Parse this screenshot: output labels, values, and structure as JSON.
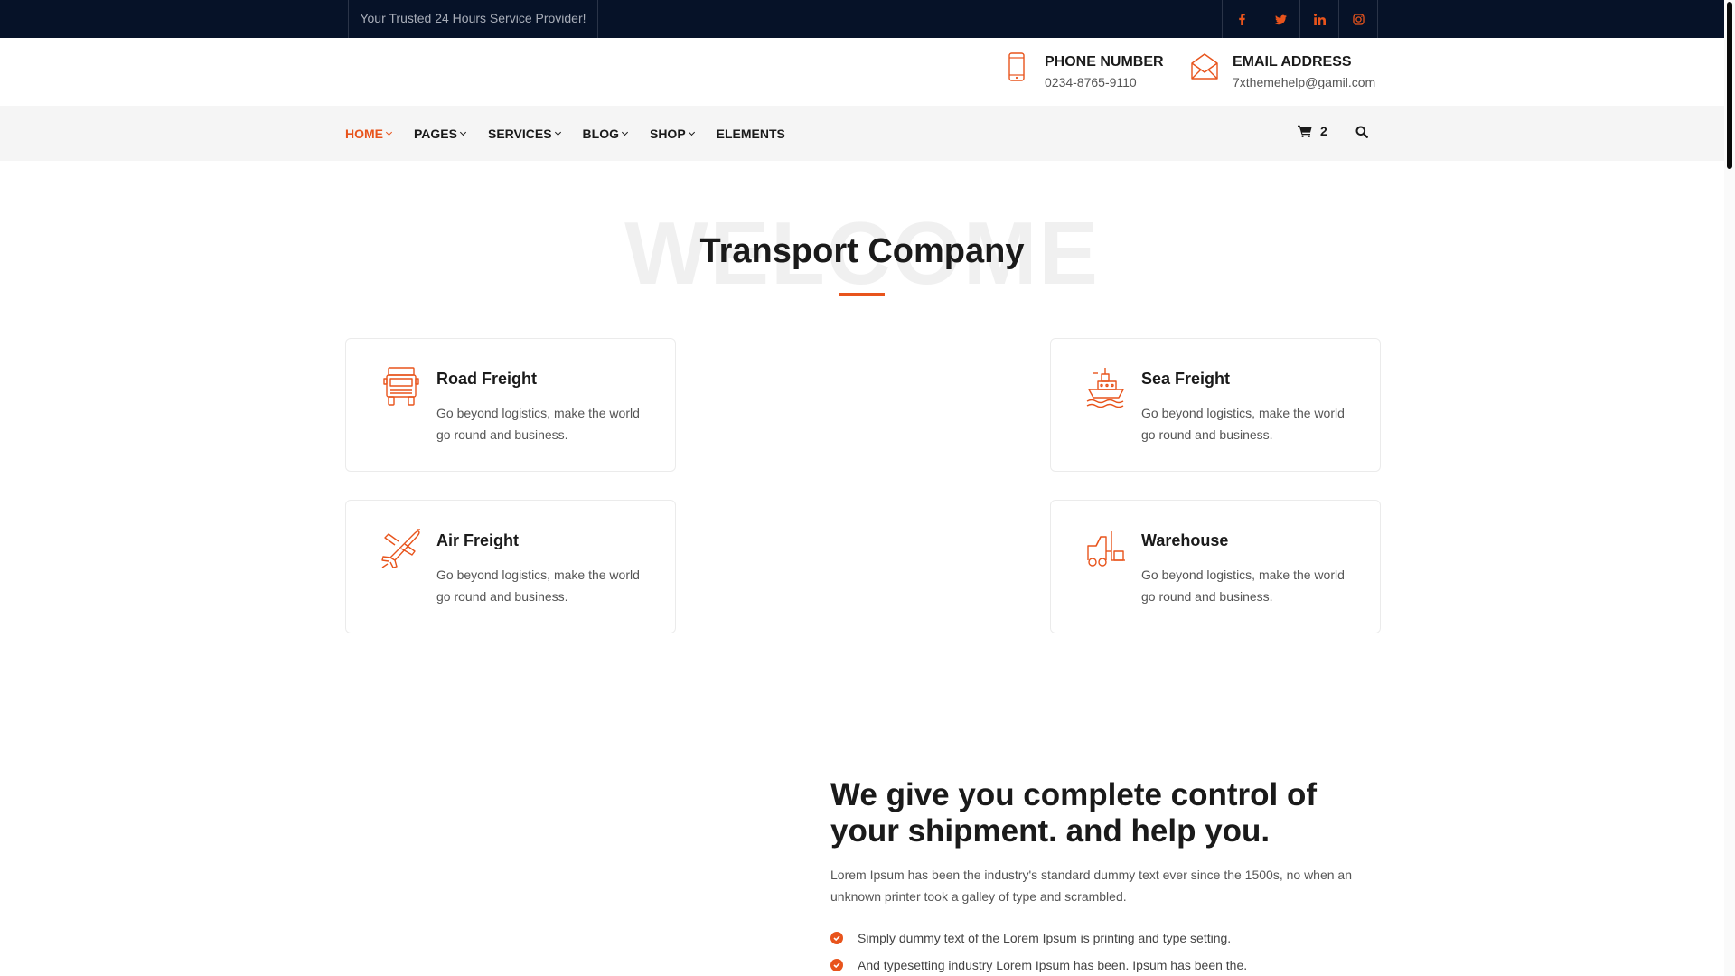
{
  "topbar": {
    "tagline": "Your Trusted 24 Hours Service Provider!",
    "socials": [
      {
        "icon": "facebook-icon"
      },
      {
        "icon": "twitter-icon"
      },
      {
        "icon": "linkedin-icon"
      },
      {
        "icon": "instagram-icon"
      }
    ]
  },
  "header": {
    "phone": {
      "label": "PHONE NUMBER",
      "value": "0234-8765-9110",
      "icon": "phone-icon"
    },
    "email": {
      "label": "EMAIL ADDRESS",
      "value": "7xthemehelp@gamil.com",
      "icon": "envelope-icon"
    }
  },
  "nav": {
    "items": [
      {
        "label": "HOME",
        "active": true,
        "dropdown": true
      },
      {
        "label": "PAGES",
        "dropdown": true
      },
      {
        "label": "SERVICES",
        "dropdown": true
      },
      {
        "label": "BLOG",
        "dropdown": true
      },
      {
        "label": "SHOP",
        "dropdown": true
      },
      {
        "label": "ELEMENTS",
        "dropdown": false
      }
    ],
    "cart_count": "2",
    "cart_icon": "cart-icon",
    "search_icon": "search-icon"
  },
  "welcome": {
    "background_word": "WELCOME",
    "title": "Transport Company"
  },
  "services": [
    {
      "title": "Road Freight",
      "desc": "Go beyond logistics, make the world go round and business.",
      "icon": "truck-icon"
    },
    {
      "title": "Sea Freight",
      "desc": "Go beyond logistics, make the world go round and business.",
      "icon": "ship-icon"
    },
    {
      "title": "Air Freight",
      "desc": "Go beyond logistics, make the world go round and business.",
      "icon": "airplane-icon"
    },
    {
      "title": "Warehouse",
      "desc": "Go beyond logistics, make the world go round and business.",
      "icon": "forklift-icon"
    }
  ],
  "about": {
    "title": "We give you complete control of your shipment. and help you.",
    "text": "Lorem Ipsum has been the industry's standard dummy text ever since the 1500s, no when an unknown printer took a galley of type and scrambled.",
    "list": [
      "Simply dummy text of the Lorem Ipsum is printing and type setting.",
      "And typesetting industry Lorem Ipsum has been. Ipsum has been the."
    ]
  },
  "colors": {
    "accent": "#e8541c",
    "topbar_bg": "#061228",
    "nav_bg": "#f5f5f5"
  }
}
